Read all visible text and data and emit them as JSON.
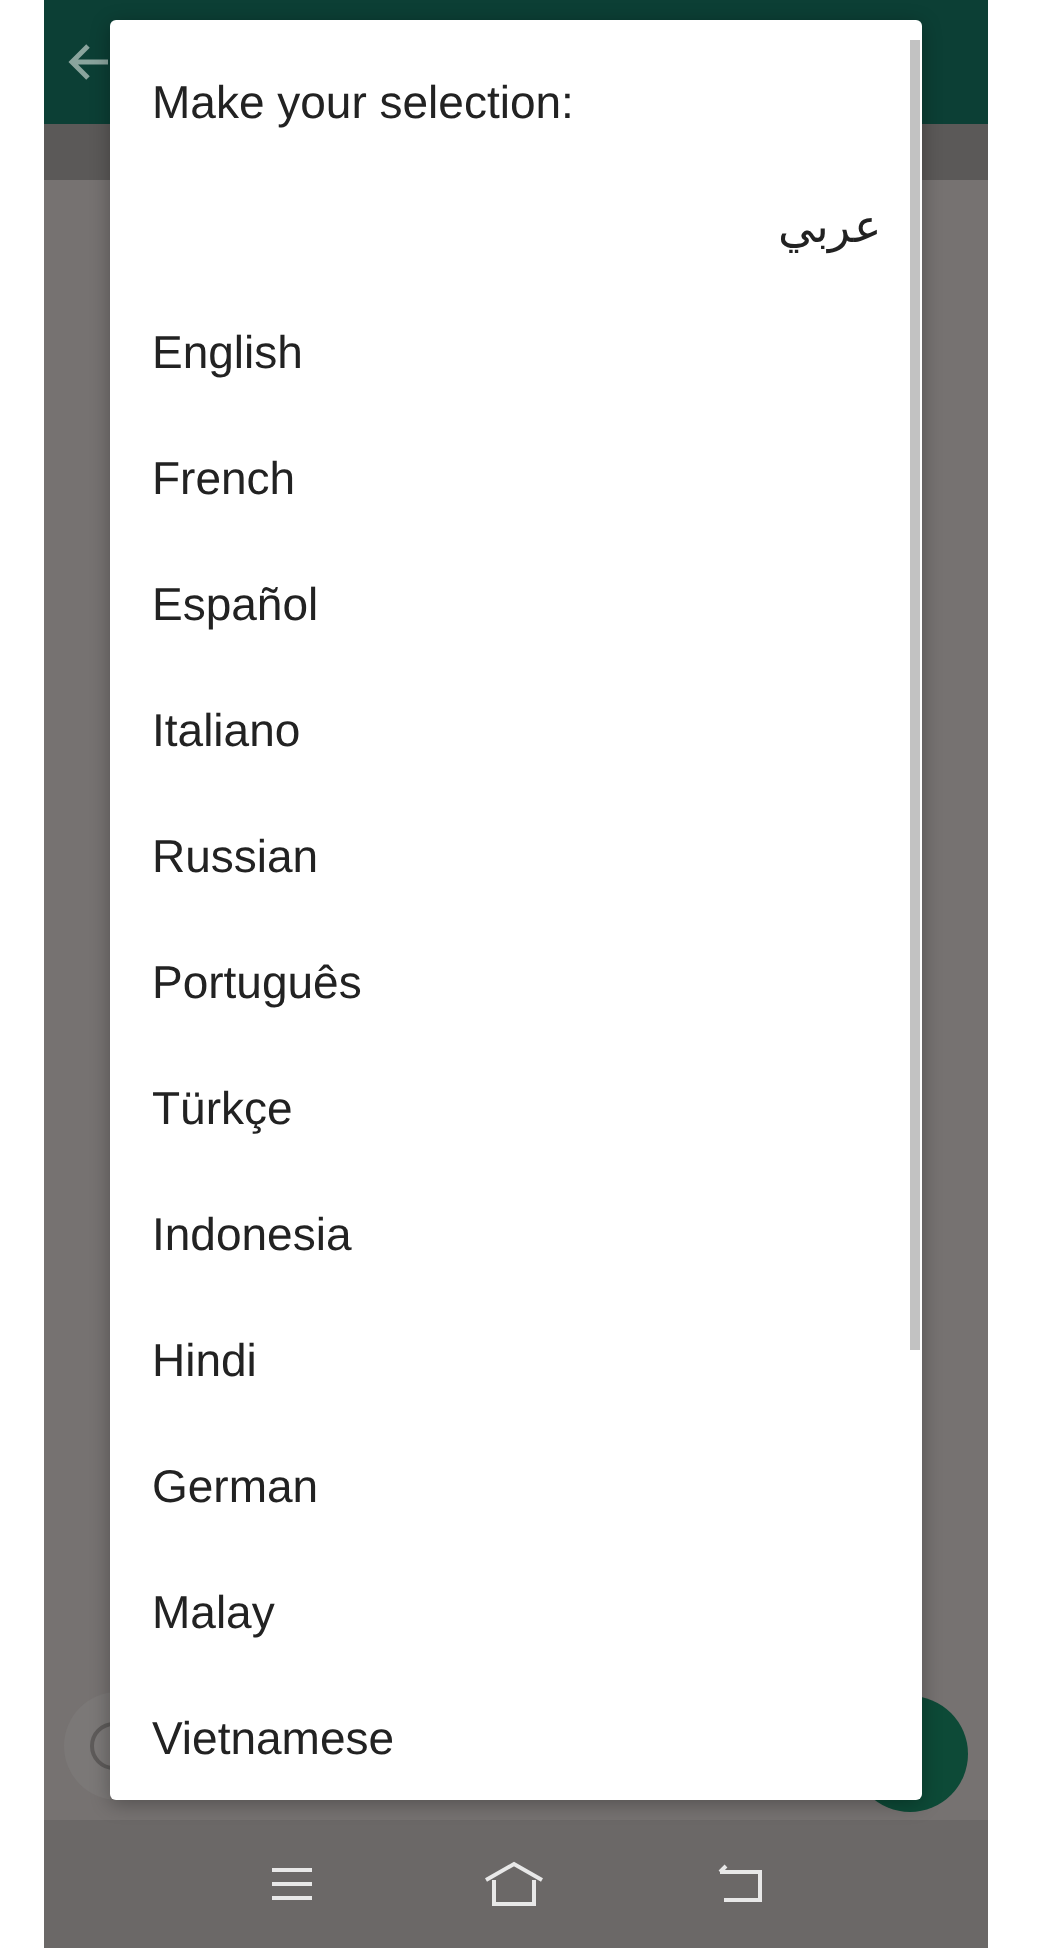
{
  "dialog": {
    "title": "Make your selection:",
    "items": [
      {
        "label": "عربي",
        "kind": "rtl"
      },
      {
        "label": "English",
        "kind": "ltr"
      },
      {
        "label": "French",
        "kind": "ltr"
      },
      {
        "label": "Español",
        "kind": "ltr"
      },
      {
        "label": "Italiano",
        "kind": "ltr"
      },
      {
        "label": "Russian",
        "kind": "ltr"
      },
      {
        "label": "Português",
        "kind": "ltr"
      },
      {
        "label": "Türkçe",
        "kind": "ltr"
      },
      {
        "label": "Indonesia",
        "kind": "ltr"
      },
      {
        "label": "Hindi",
        "kind": "ltr"
      },
      {
        "label": "German",
        "kind": "ltr"
      },
      {
        "label": "Malay",
        "kind": "ltr"
      },
      {
        "label": "Vietnamese",
        "kind": "ltr"
      }
    ]
  }
}
